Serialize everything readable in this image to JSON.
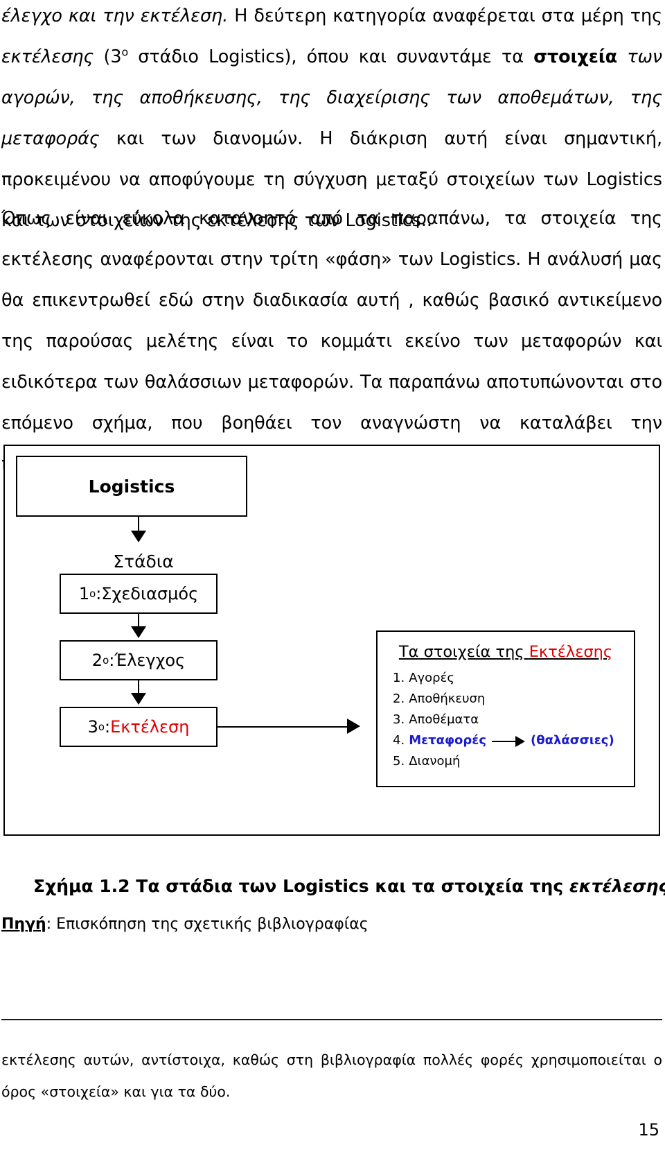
{
  "document": {
    "page_number": "15",
    "paragraphs": [
      {
        "id": "p1",
        "runs": [
          {
            "text": "έλεγχο και την εκτέλεση.",
            "style": "italic"
          },
          {
            "text": " Η δεύτερη κατηγορία αναφέρεται στα μέρη της ",
            "style": "normal"
          },
          {
            "text": "εκτέλεσης",
            "style": "italic"
          },
          {
            "text": " (3",
            "style": "normal"
          },
          {
            "text": "ο",
            "style": "sup"
          },
          {
            "text": " στάδιο Logistics), όπου και συναντάμε τα ",
            "style": "normal"
          },
          {
            "text": "στοιχεία",
            "style": "bold-italic"
          },
          {
            "text": " των αγορών, της αποθήκευσης, της διαχείρισης των αποθεμάτων,  της ",
            "style": "italic"
          },
          {
            "text": "μεταφοράς",
            "style": "italic"
          },
          {
            "text": " και των διανομών.",
            "style": "normal"
          },
          {
            "text": " Η διάκριση αυτή είναι σημαντική, προκειμένου να αποφύγουμε τη σύγχυση μεταξύ στοιχείων των Logistics και των στοιχείων της εκτέλεσης των Logistics..",
            "style": "normal"
          }
        ]
      },
      {
        "id": "p2",
        "text": "Όπως είναι εύκολα κατανοητό από τα παραπάνω, τα στοιχεία της εκτέλεσης αναφέρονται στην τρίτη «φάση» των Logistics. Η ανάλυσή μας θα επικεντρωθεί εδώ στην διαδικασία αυτή , καθώς βασικό αντικείμενο της παρούσας μελέτης είναι το κομμάτι εκείνο των μεταφορών και ειδικότερα των θαλάσσιων μεταφορών. Τα παραπάνω αποτυπώνονται στο επόμενο σχήμα, που βοηθάει τον αναγνώστη να καταλάβει την προσέγγιση που θα ακολουθηθεί στην παρούσα μελέτη:"
      }
    ],
    "figure": {
      "root_node": "Logistics",
      "stages_label": "Στάδια",
      "stages": [
        {
          "ordinal": "1",
          "superscript": "ο",
          "separator": ": ",
          "label": "Σχεδιασμός",
          "color": "#000000"
        },
        {
          "ordinal": "2",
          "superscript": "ο",
          "separator": ": ",
          "label": "Έλεγχος",
          "color": "#000000"
        },
        {
          "ordinal": "3",
          "superscript": "ο",
          "separator": ": ",
          "label": "Εκτέλεση",
          "color": "#e00000"
        }
      ],
      "elements_box": {
        "title_prefix": "Τα στοιχεία της ",
        "title_highlight": "Εκτέλεσης",
        "items": [
          {
            "num": "1.",
            "label": "Αγορές",
            "color": "#000000",
            "has_arrow": false,
            "suffix": ""
          },
          {
            "num": "2.",
            "label": "Αποθήκευση",
            "color": "#000000",
            "has_arrow": false,
            "suffix": ""
          },
          {
            "num": "3.",
            "label": "Αποθέματα",
            "color": "#000000",
            "has_arrow": false,
            "suffix": ""
          },
          {
            "num": "4.",
            "label": "Μεταφορές",
            "color": "#1a1ad0",
            "has_arrow": true,
            "suffix": "(θαλάσσιες)"
          },
          {
            "num": "5.",
            "label": "Διανομή",
            "color": "#000000",
            "has_arrow": false,
            "suffix": ""
          }
        ]
      }
    },
    "caption": {
      "prefix": "Σχήμα 1.2 Τα στάδια των Logistics και τα στοιχεία της ",
      "emphasis": "εκτέλεσης"
    },
    "source": {
      "label": "Πηγή",
      "text": ": Επισκόπηση της σχετικής βιβλιογραφίας"
    },
    "footnote": {
      "text": "εκτέλεσης αυτών, αντίστοιχα, καθώς στη βιβλιογραφία πολλές φορές χρησιμοποιείται ο όρος «στοιχεία» και για τα δύο."
    },
    "colors": {
      "red": "#e00000",
      "blue": "#1a1ad0",
      "black": "#000000"
    }
  }
}
